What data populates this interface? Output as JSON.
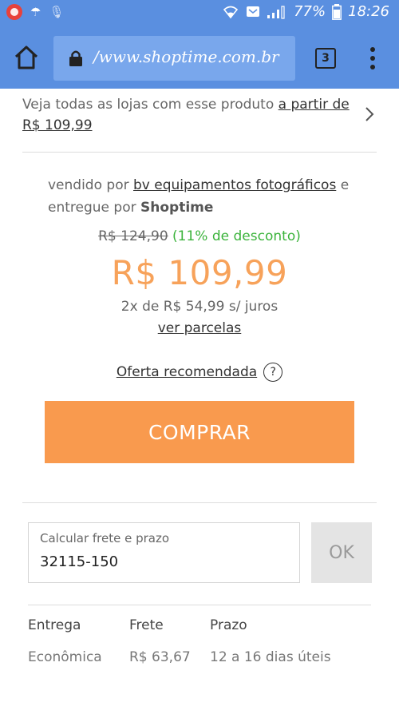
{
  "status_bar": {
    "battery": "77%",
    "time": "18:26"
  },
  "browser": {
    "url": "/www.shoptime.com.br",
    "tab_count": "3"
  },
  "product": {
    "stores_prefix": "Veja todas as lojas com esse produto ",
    "stores_link": "a partir de R$ 109,99",
    "sold_by_prefix": "vendido por ",
    "seller_name": "bv equipamentos fotográficos",
    "delivered_by_prefix": " e entregue por ",
    "deliverer": "Shoptime",
    "old_price": "R$ 124,90",
    "discount": " (11% de desconto)",
    "price": "R$ 109,99",
    "installments": "2x de R$ 54,99 s/ juros",
    "see_installments": "ver parcelas",
    "recommended_offer": "Oferta recomendada",
    "help_symbol": "?",
    "buy_label": "COMPRAR"
  },
  "freight": {
    "placeholder": "Calcular frete e prazo",
    "cep_value": "32115-150",
    "ok_label": "OK",
    "columns": [
      "Entrega",
      "Frete",
      "Prazo"
    ],
    "rows": [
      [
        "Econômica",
        "R$ 63,67",
        "12 a 16 dias úteis"
      ]
    ]
  }
}
